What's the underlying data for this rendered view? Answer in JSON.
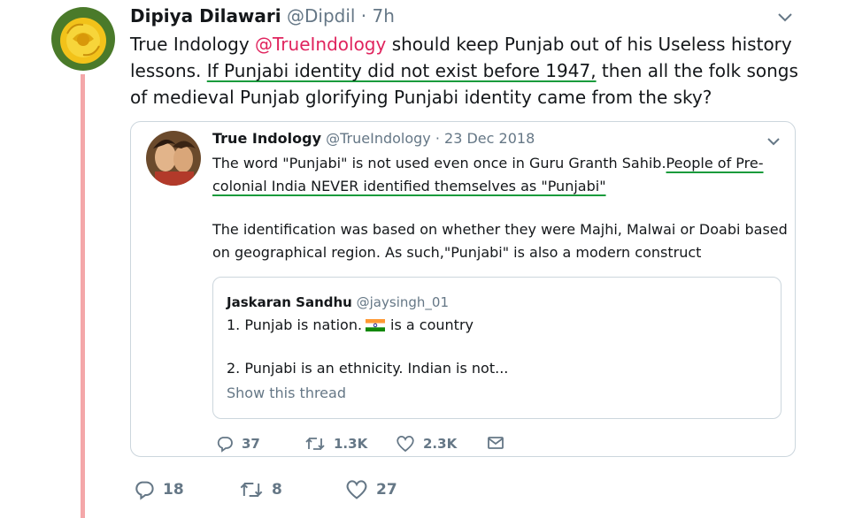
{
  "tweet": {
    "author_name": "Dipiya Dilawari",
    "author_handle": "@Dipdil",
    "separator": " · ",
    "time": "7h",
    "text_part1": "True Indology ",
    "mention": "@TrueIndology",
    "text_part2": " should keep Punjab out of his Useless history lessons.  ",
    "text_underlined": "If Punjabi identity did not exist before 1947,",
    "text_part3": " then all the folk songs of medieval Punjab glorifying Punjabi identity came from the sky?",
    "replies": "18",
    "retweets": "8",
    "likes": "27"
  },
  "quoted": {
    "author_name": "True Indology",
    "author_handle": "@TrueIndology",
    "separator": " · ",
    "date": "23 Dec 2018",
    "para1_part1": "The word \"Punjabi\" is not used even once in Guru Granth Sahib.",
    "para1_underlined": "People of Pre-colonial India NEVER identified themselves as \"Punjabi\"",
    "para2": "The identification was based on whether they were Majhi, Malwai or Doabi based on geographical region. As such,\"Punjabi\" is also a modern construct",
    "replies": "37",
    "retweets": "1.3K",
    "likes": "2.3K"
  },
  "inner_quote": {
    "author_name": "Jaskaran Sandhu",
    "author_handle": "@jaysingh_01",
    "line1_part1": "1. Punjab is nation.",
    "line1_part2": "is a country",
    "line2": "2. Punjabi is an ethnicity. Indian is not...",
    "show_thread": "Show this thread"
  },
  "icons": {
    "chevron": "chevron-down-icon",
    "reply": "reply-icon",
    "retweet": "retweet-icon",
    "like": "heart-icon",
    "dm": "envelope-icon",
    "flag": "india-flag-icon"
  },
  "colors": {
    "mention": "#e0245e",
    "thread_line": "#f4a7a9",
    "highlight_underline": "#1a9b3c",
    "muted": "#657786"
  }
}
